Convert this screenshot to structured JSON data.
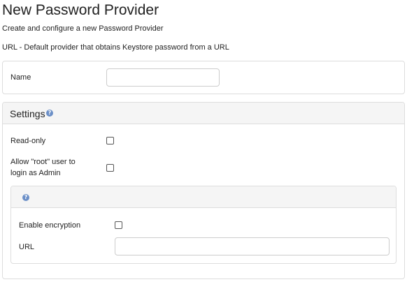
{
  "page": {
    "title": "New Password Provider",
    "subtitle": "Create and configure a new Password Provider",
    "provider_description": "URL - Default provider that obtains Keystore password from a URL"
  },
  "name_section": {
    "name_label": "Name",
    "name_value": ""
  },
  "settings": {
    "heading": "Settings",
    "help_icon": "question-circle-icon",
    "read_only_label": "Read-only",
    "read_only_checked": false,
    "allow_root_label_line1": "Allow \"root\" user to",
    "allow_root_label_line2": "login as Admin",
    "allow_root_checked": false,
    "nested": {
      "help_icon": "question-circle-icon",
      "enable_encryption_label": "Enable encryption",
      "enable_encryption_checked": false,
      "url_label": "URL",
      "url_value": ""
    }
  },
  "colors": {
    "help_icon": "#6b8fc7",
    "panel_border": "#dddddd",
    "panel_heading_bg": "#f5f5f5"
  }
}
